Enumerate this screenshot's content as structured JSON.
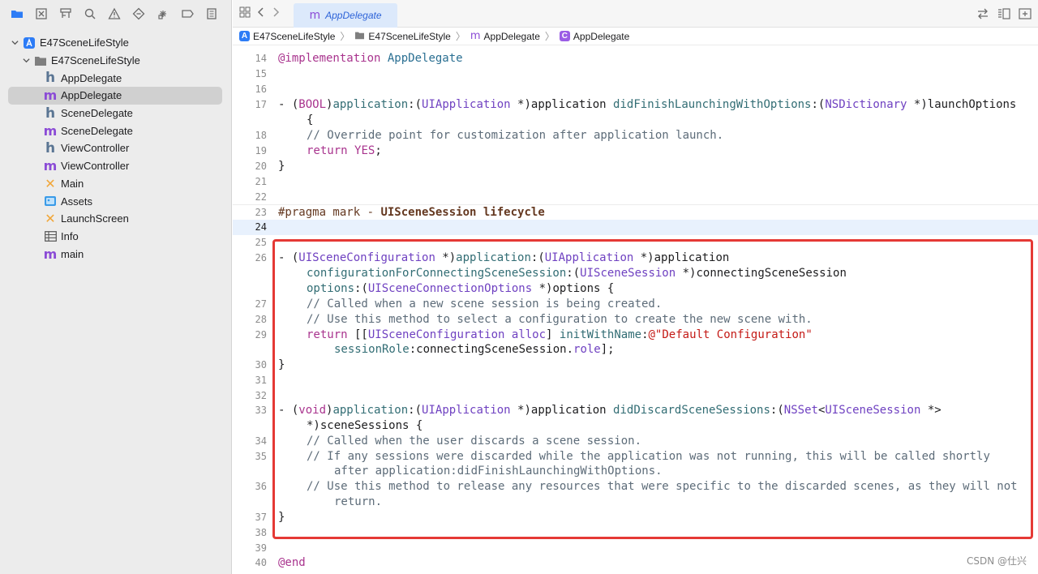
{
  "sidebar": {
    "toolbar_icons": [
      "folder-icon",
      "source-control-icon",
      "hierarchy-icon",
      "search-icon",
      "warning-icon",
      "test-icon",
      "debug-icon",
      "breakpoint-icon",
      "report-icon"
    ],
    "tree": [
      {
        "label": "E47SceneLifeStyle",
        "icon": "project-icon",
        "level": 0,
        "expanded": true
      },
      {
        "label": "E47SceneLifeStyle",
        "icon": "folder-icon",
        "level": 1,
        "expanded": true
      },
      {
        "label": "AppDelegate",
        "icon": "header-file-icon",
        "glyph": "h",
        "level": 2
      },
      {
        "label": "AppDelegate",
        "icon": "objc-file-icon",
        "glyph": "m",
        "level": 2,
        "selected": true
      },
      {
        "label": "SceneDelegate",
        "icon": "header-file-icon",
        "glyph": "h",
        "level": 2
      },
      {
        "label": "SceneDelegate",
        "icon": "objc-file-icon",
        "glyph": "m",
        "level": 2
      },
      {
        "label": "ViewController",
        "icon": "header-file-icon",
        "glyph": "h",
        "level": 2
      },
      {
        "label": "ViewController",
        "icon": "objc-file-icon",
        "glyph": "m",
        "level": 2
      },
      {
        "label": "Main",
        "icon": "storyboard-icon",
        "glyph": "✕",
        "level": 2
      },
      {
        "label": "Assets",
        "icon": "asset-catalog-icon",
        "level": 2
      },
      {
        "label": "LaunchScreen",
        "icon": "storyboard-icon",
        "glyph": "✕",
        "level": 2
      },
      {
        "label": "Info",
        "icon": "plist-table-icon",
        "level": 2
      },
      {
        "label": "main",
        "icon": "objc-file-icon",
        "glyph": "m",
        "level": 2
      }
    ]
  },
  "tab": {
    "glyph": "m",
    "label": "AppDelegate"
  },
  "jumpbar": [
    {
      "label": "E47SceneLifeStyle",
      "icon": "project-icon"
    },
    {
      "label": "E47SceneLifeStyle",
      "icon": "folder-icon"
    },
    {
      "label": "AppDelegate",
      "icon": "objc-file-icon",
      "glyph": "m"
    },
    {
      "label": "AppDelegate",
      "icon": "class-icon",
      "glyph": "C"
    }
  ],
  "code": {
    "line_numbers": {
      "l14": "14",
      "l15": "15",
      "l16": "16",
      "l17": "17",
      "l18": "18",
      "l19": "19",
      "l20": "20",
      "l21": "21",
      "l22": "22",
      "l23": "23",
      "l24": "24",
      "l25": "25",
      "l26": "26",
      "l27": "27",
      "l28": "28",
      "l29": "29",
      "l30": "30",
      "l31": "31",
      "l32": "32",
      "l33": "33",
      "l34": "34",
      "l35": "35",
      "l36": "36",
      "l37": "37",
      "l38": "38",
      "l39": "39",
      "l40": "40"
    },
    "lines": {
      "l14": [
        [
          "impl",
          "@implementation"
        ],
        [
          "plain",
          " "
        ],
        [
          "implname",
          "AppDelegate"
        ]
      ],
      "l17a": [
        [
          "plain",
          "- ("
        ],
        [
          "kw",
          "BOOL"
        ],
        [
          "plain",
          ")"
        ],
        [
          "meth",
          "application"
        ],
        [
          "plain",
          ":("
        ],
        [
          "typ",
          "UIApplication"
        ],
        [
          "plain",
          " *)application "
        ],
        [
          "meth",
          "didFinishLaunchingWithOptions"
        ],
        [
          "plain",
          ":("
        ],
        [
          "typ",
          "NSDictionary"
        ],
        [
          "plain",
          " *)launchOptions"
        ]
      ],
      "l17b": [
        [
          "plain",
          "{"
        ]
      ],
      "l18": [
        [
          "cmt",
          "// Override point for customization after application launch."
        ]
      ],
      "l19": [
        [
          "kw",
          "return"
        ],
        [
          "plain",
          " "
        ],
        [
          "kw",
          "YES"
        ],
        [
          "plain",
          ";"
        ]
      ],
      "l20": [
        [
          "plain",
          "}"
        ]
      ],
      "l23": [
        [
          "pp",
          "#pragma mark"
        ],
        [
          "plain",
          " "
        ],
        [
          "pp",
          "- "
        ],
        [
          "ppb",
          "UISceneSession lifecycle"
        ]
      ],
      "l26a": [
        [
          "plain",
          "- ("
        ],
        [
          "typ",
          "UISceneConfiguration"
        ],
        [
          "plain",
          " *)"
        ],
        [
          "meth",
          "application"
        ],
        [
          "plain",
          ":("
        ],
        [
          "typ",
          "UIApplication"
        ],
        [
          "plain",
          " *)application"
        ]
      ],
      "l26b": [
        [
          "meth",
          "configurationForConnectingSceneSession"
        ],
        [
          "plain",
          ":("
        ],
        [
          "typ",
          "UISceneSession"
        ],
        [
          "plain",
          " *)connectingSceneSession"
        ]
      ],
      "l26c": [
        [
          "meth",
          "options"
        ],
        [
          "plain",
          ":("
        ],
        [
          "typ",
          "UISceneConnectionOptions"
        ],
        [
          "plain",
          " *)options {"
        ]
      ],
      "l27": [
        [
          "cmt",
          "// Called when a new scene session is being created."
        ]
      ],
      "l28": [
        [
          "cmt",
          "// Use this method to select a configuration to create the new scene with."
        ]
      ],
      "l29a": [
        [
          "kw",
          "return"
        ],
        [
          "plain",
          " [["
        ],
        [
          "typ",
          "UISceneConfiguration"
        ],
        [
          "plain",
          " "
        ],
        [
          "typ",
          "alloc"
        ],
        [
          "plain",
          "] "
        ],
        [
          "meth",
          "initWithName"
        ],
        [
          "plain",
          ":"
        ],
        [
          "str",
          "@\"Default Configuration\""
        ]
      ],
      "l29b": [
        [
          "meth",
          "sessionRole"
        ],
        [
          "plain",
          ":connectingSceneSession."
        ],
        [
          "typ",
          "role"
        ],
        [
          "plain",
          "];"
        ]
      ],
      "l30": [
        [
          "plain",
          "}"
        ]
      ],
      "l33a": [
        [
          "plain",
          "- ("
        ],
        [
          "kw",
          "void"
        ],
        [
          "plain",
          ")"
        ],
        [
          "meth",
          "application"
        ],
        [
          "plain",
          ":("
        ],
        [
          "typ",
          "UIApplication"
        ],
        [
          "plain",
          " *)application "
        ],
        [
          "meth",
          "didDiscardSceneSessions"
        ],
        [
          "plain",
          ":("
        ],
        [
          "typ",
          "NSSet"
        ],
        [
          "plain",
          "<"
        ],
        [
          "typ",
          "UISceneSession"
        ],
        [
          "plain",
          " *>"
        ]
      ],
      "l33b": [
        [
          "plain",
          "*)sceneSessions {"
        ]
      ],
      "l34": [
        [
          "cmt",
          "// Called when the user discards a scene session."
        ]
      ],
      "l35a": [
        [
          "cmt",
          "// If any sessions were discarded while the application was not running, this will be called shortly"
        ]
      ],
      "l35b": [
        [
          "cmt",
          "after application:didFinishLaunchingWithOptions."
        ]
      ],
      "l36a": [
        [
          "cmt",
          "// Use this method to release any resources that were specific to the discarded scenes, as they will not"
        ]
      ],
      "l36b": [
        [
          "cmt",
          "return."
        ]
      ],
      "l37": [
        [
          "plain",
          "}"
        ]
      ],
      "l40": [
        [
          "impl",
          "@end"
        ]
      ]
    }
  },
  "watermark": "CSDN @仕兴",
  "colors": {
    "highlight_box": "#e53935",
    "selection": "#d0d0d0",
    "current_line": "#e8f1fd"
  }
}
